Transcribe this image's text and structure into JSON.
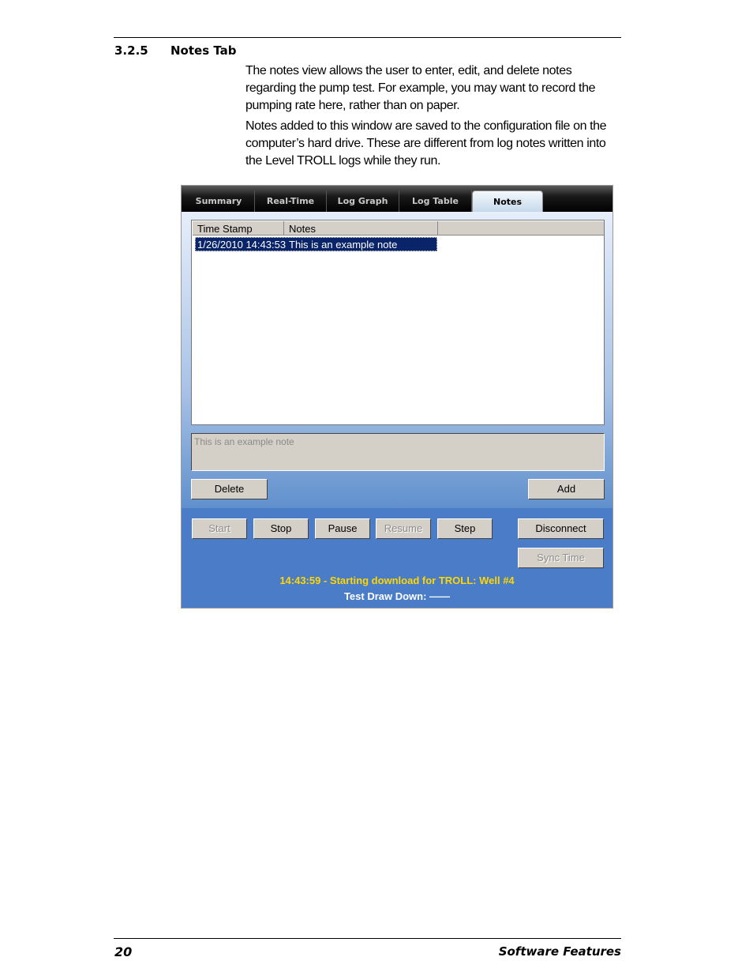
{
  "section": {
    "number": "3.2.5",
    "title": "Notes Tab"
  },
  "paragraphs": [
    "The notes view allows the user to enter, edit, and delete notes regarding the pump test. For example, you may want to record the pumping rate here, rather than on paper.",
    "Notes added to this window are saved to the configuration file on the computer’s hard drive. These are different from log notes written into the Level TROLL logs while they run."
  ],
  "app": {
    "tabs": [
      "Summary",
      "Real-Time",
      "Log Graph",
      "Log Table",
      "Notes"
    ],
    "active_tab": "Notes",
    "table": {
      "columns": [
        "Time Stamp",
        "Notes"
      ],
      "rows": [
        {
          "timestamp": "1/26/2010 14:43:53",
          "note": "This is an example note"
        }
      ]
    },
    "note_input": "This is an example note",
    "delete_label": "Delete",
    "add_label": "Add",
    "controls": {
      "start": "Start",
      "stop": "Stop",
      "pause": "Pause",
      "resume": "Resume",
      "step": "Step",
      "disconnect": "Disconnect",
      "sync_time": "Sync Time"
    },
    "status_message": "14:43:59 - Starting download for TROLL: Well #4",
    "draw_down_label": "Test Draw Down: ——",
    "colors": {
      "status": "#ffd700",
      "bottom_panel": "#4a7cc8",
      "selection": "#0a246a"
    }
  },
  "footer": {
    "page_number": "20",
    "chapter": "Software Features"
  }
}
